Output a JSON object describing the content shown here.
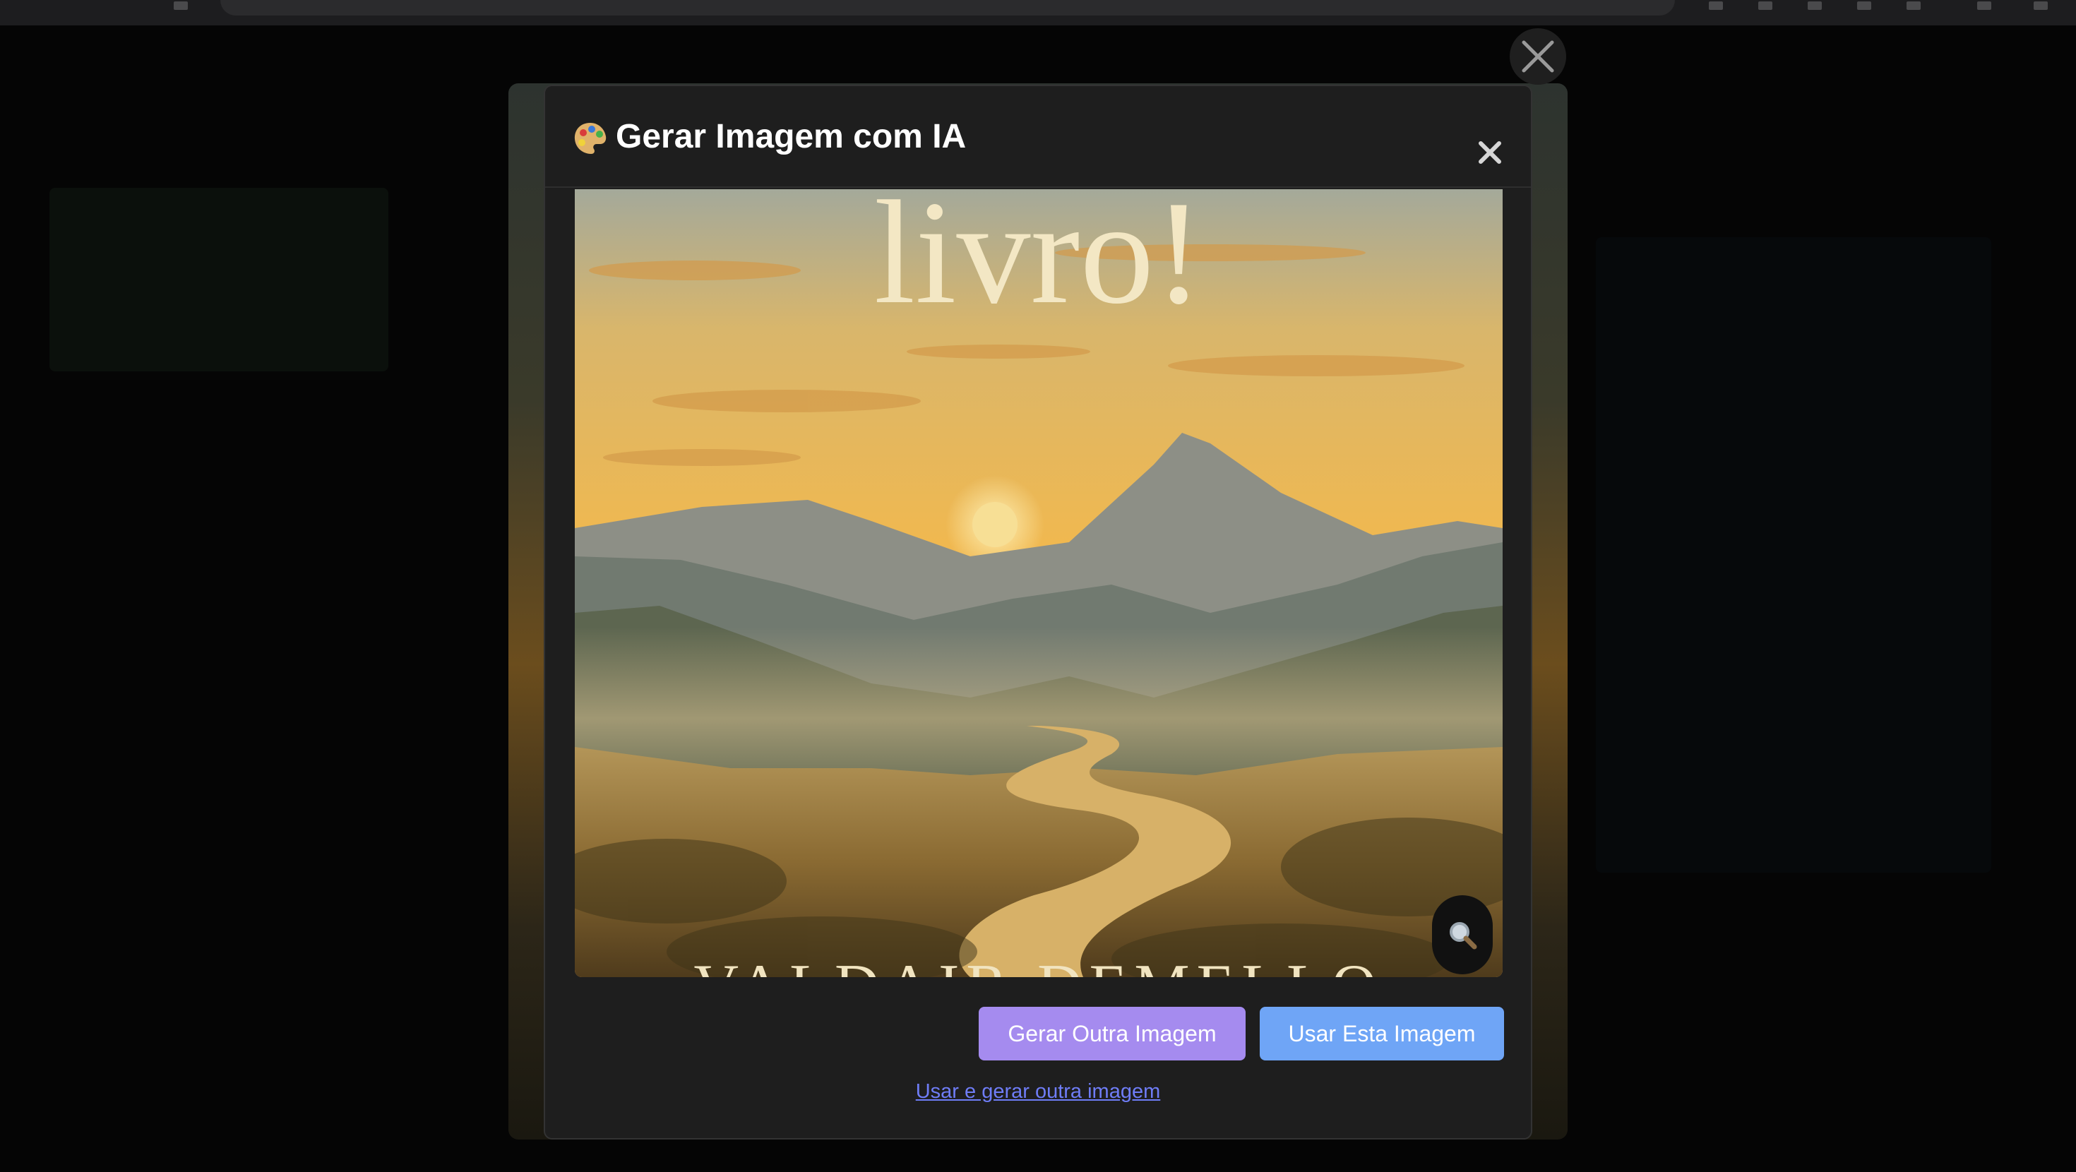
{
  "modal": {
    "title": "Gerar Imagem com IA",
    "title_icon": "palette-icon",
    "close_icon": "close-icon"
  },
  "overlay": {
    "close_icon": "close-icon"
  },
  "preview": {
    "cover_title": "livro!",
    "cover_author": "VALDAIR DEMELLO",
    "zoom_icon": "magnifier-icon",
    "scene": "mountain valley at sunset with winding path"
  },
  "actions": {
    "generate_another": "Gerar Outra Imagem",
    "use_this": "Usar Esta Imagem",
    "use_and_generate": "Usar e gerar outra imagem"
  },
  "colors": {
    "modal_bg": "#1e1e1e",
    "generate_button": "#a58bef",
    "use_button": "#6fa5f6",
    "link": "#6f7df7"
  }
}
